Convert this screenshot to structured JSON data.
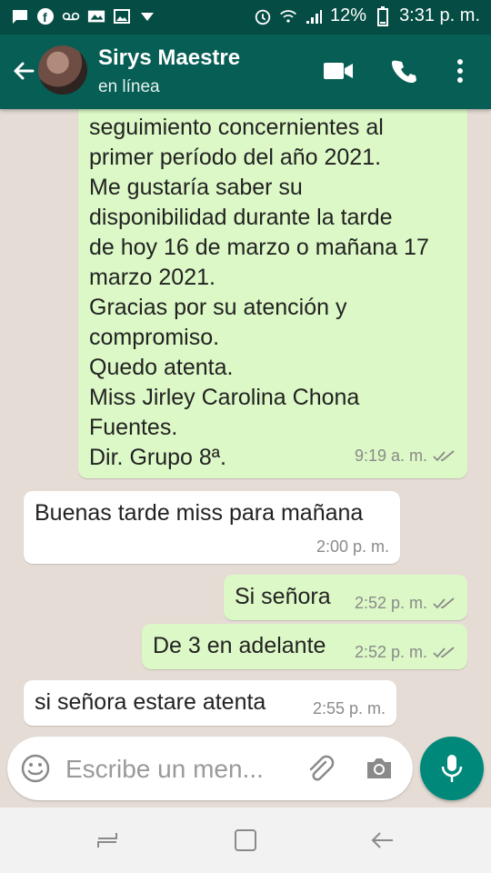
{
  "status_bar": {
    "battery": "12%",
    "time": "3:31 p. m."
  },
  "header": {
    "contact_name": "Sirys Maestre",
    "status": "en línea"
  },
  "messages": [
    {
      "direction": "outgoing",
      "lines": [
        "seguimiento concernientes al",
        "primer período del año 2021.",
        "Me gustaría saber su",
        "disponibilidad durante la tarde",
        "de hoy 16 de marzo o mañana 17",
        "marzo 2021.",
        "Gracias por su atención y",
        "compromiso.",
        "Quedo atenta.",
        "Miss Jirley Carolina Chona",
        "Fuentes.",
        "Dir. Grupo 8ª."
      ],
      "time": "9:19 a. m."
    },
    {
      "direction": "incoming",
      "text": "Buenas tarde miss para mañana",
      "time": "2:00 p. m."
    },
    {
      "direction": "outgoing",
      "text": "Si señora",
      "time": "2:52 p. m."
    },
    {
      "direction": "outgoing",
      "text": "De 3 en adelante",
      "time": "2:52 p. m."
    },
    {
      "direction": "incoming",
      "text": "si señora estare atenta",
      "time": "2:55 p. m."
    }
  ],
  "composer": {
    "placeholder": "Escribe un men..."
  },
  "icons": {
    "status_left": [
      "message-icon",
      "facebook-icon",
      "voicemail-icon",
      "photo-icon",
      "gallery-icon",
      "dropdown-icon"
    ],
    "status_right": [
      "alarm-icon",
      "wifi-icon",
      "signal-icon",
      "battery-icon"
    ],
    "header": [
      "back-arrow-icon",
      "video-call-icon",
      "phone-icon",
      "more-vert-icon"
    ],
    "composer": [
      "emoji-icon",
      "attach-icon",
      "camera-icon",
      "mic-icon"
    ],
    "nav": [
      "recent-apps-icon",
      "home-icon",
      "back-icon"
    ]
  },
  "colors": {
    "header_bg": "#075e54",
    "status_bg": "#054d44",
    "chat_bg": "#e5ddd5",
    "outgoing_bubble": "#dcf8c6",
    "incoming_bubble": "#ffffff",
    "accent": "#00897b"
  }
}
